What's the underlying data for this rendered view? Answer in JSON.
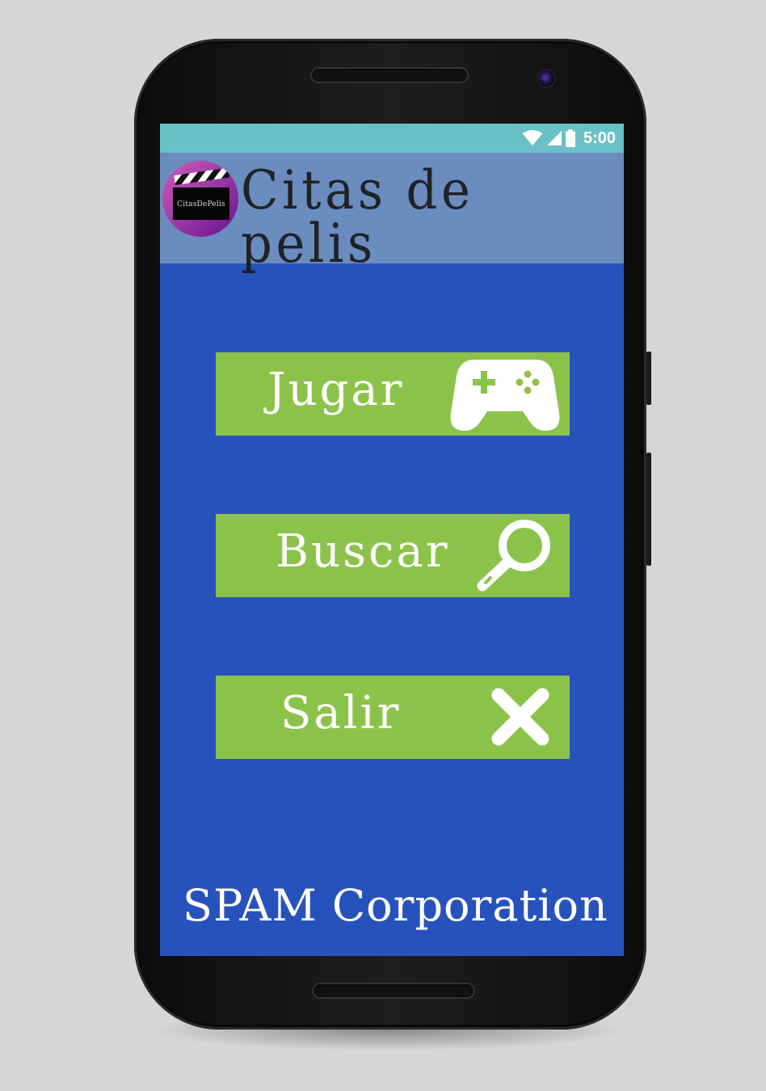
{
  "status_bar": {
    "time": "5:00",
    "wifi_icon": "wifi-icon",
    "signal_icon": "signal-icon",
    "battery_icon": "battery-icon"
  },
  "app_bar": {
    "logo_text": "CitasDePelis",
    "title": "Citas de pelis"
  },
  "menu": {
    "items": [
      {
        "label": "Jugar",
        "icon": "gamepad-icon"
      },
      {
        "label": "Buscar",
        "icon": "magnifier-icon"
      },
      {
        "label": "Salir",
        "icon": "close-icon"
      }
    ]
  },
  "footer": {
    "text": "SPAM Corporation"
  },
  "colors": {
    "status_bar": "#6ac1c5",
    "app_bar": "#6b8cbf",
    "background": "#2852bb",
    "button": "#8bc34a",
    "button_text": "#ffffff"
  }
}
